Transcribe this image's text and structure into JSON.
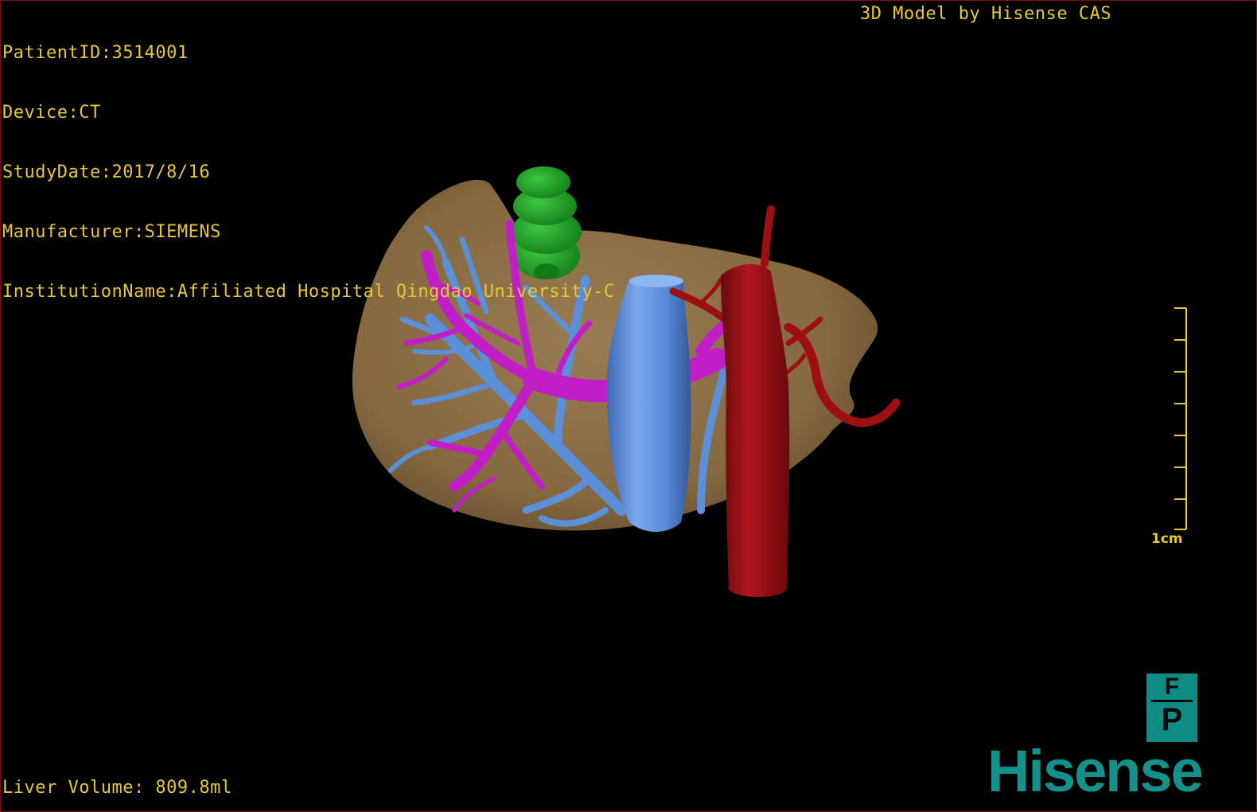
{
  "study_info": {
    "patient_id": "PatientID:3514001",
    "device": "Device:CT",
    "study_date": "StudyDate:2017/8/16",
    "manufacturer": "Manufacturer:SIEMENS",
    "institution": "InstitutionName:Affiliated Hospital Qingdao University-C"
  },
  "model_credit": "3D Model by Hisense CAS",
  "liver_volume": "Liver Volume: 809.8ml",
  "scale_bar": {
    "label": "1cm"
  },
  "logo": {
    "fp_top": "F",
    "fp_bottom": "P",
    "brand": "Hisense"
  },
  "colors": {
    "overlay_text": "#e8c832",
    "liver": "#8b6e4a",
    "portal_vein": "#c21ec8",
    "hepatic_vein": "#5b8fd8",
    "artery": "#9e0f12",
    "gallbladder": "#1fa424",
    "brand": "#14918a"
  }
}
